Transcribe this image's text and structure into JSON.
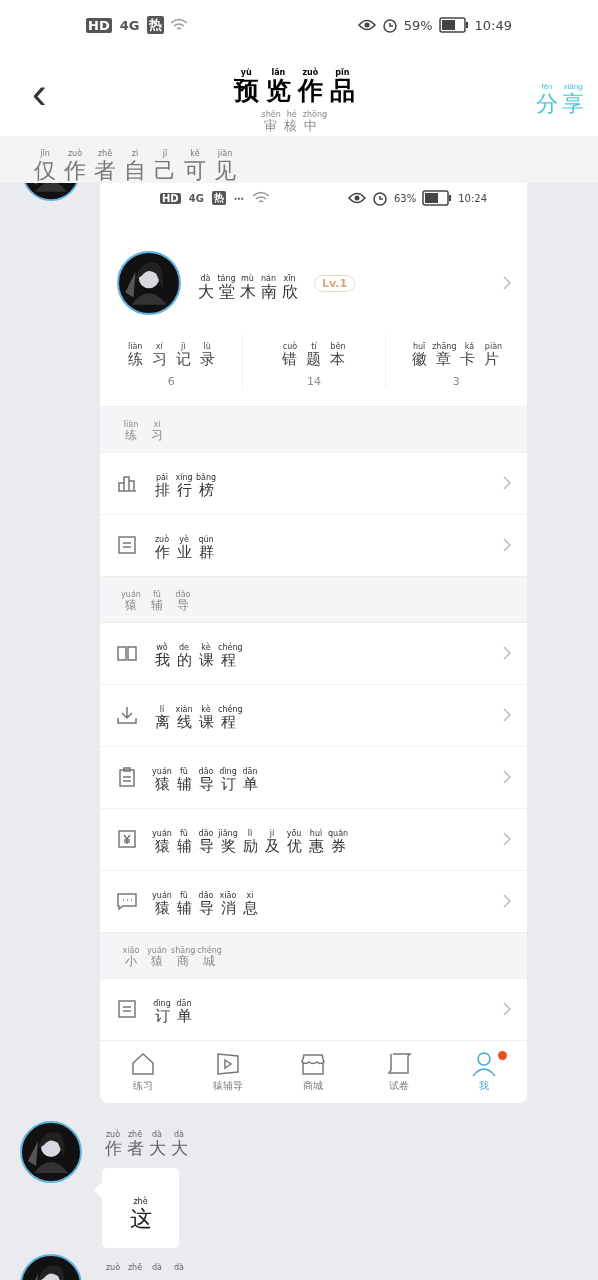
{
  "status_bar": {
    "left": [
      "HD",
      "4G",
      "热"
    ],
    "battery_level": "59%",
    "time": "10:49"
  },
  "header": {
    "back": "‹",
    "title": {
      "text": "预览作品",
      "pinyin": "yù lǎn zuò pǐn"
    },
    "subtitle": {
      "text": "审核中",
      "pinyin": "shěn hé zhōng"
    },
    "action": {
      "text": "分享",
      "pinyin": "fēn xiǎng"
    }
  },
  "notice": {
    "text": "仅作者自己可见",
    "pinyin": "jǐn zuò zhě zì jǐ kě jiàn"
  },
  "shot": {
    "status_bar": {
      "left": [
        "HD",
        "4G",
        "热",
        "⋯"
      ],
      "battery_level": "63%",
      "time": "10:24"
    },
    "profile": {
      "name": {
        "text": "大堂木南欣",
        "pinyin": "dà táng mù nán xīn"
      },
      "badge": "Lv.1"
    },
    "stats": [
      {
        "label": {
          "text": "练习记录",
          "pinyin": "liàn xí jì lù"
        },
        "value": "6"
      },
      {
        "label": {
          "text": "错题本",
          "pinyin": "cuò tí běn"
        },
        "value": "14"
      },
      {
        "label": {
          "text": "徽章卡片",
          "pinyin": "huī zhāng kǎ piàn"
        },
        "value": "3"
      }
    ],
    "sections": [
      {
        "title": {
          "text": "练习",
          "pinyin": "liàn xí"
        },
        "items": [
          {
            "kind": "chart",
            "label": {
              "text": "排行榜",
              "pinyin": "pái xíng bǎng"
            }
          },
          {
            "kind": "list",
            "label": {
              "text": "作业群",
              "pinyin": "zuò yè qún"
            }
          }
        ]
      },
      {
        "title": {
          "text": "猿辅导",
          "pinyin": "yuán fǔ dǎo"
        },
        "items": [
          {
            "kind": "book",
            "label": {
              "text": "我的课程",
              "pinyin": "wǒ de kè chéng"
            }
          },
          {
            "kind": "download",
            "label": {
              "text": "离线课程",
              "pinyin": "lí xiàn kè chéng"
            }
          },
          {
            "kind": "clipboard",
            "label": {
              "text": "猿辅导订单",
              "pinyin": "yuán fǔ dǎo dìng dān"
            }
          },
          {
            "kind": "yen",
            "label": {
              "text": "猿辅导奖励及优惠券",
              "pinyin": "yuán fǔ dǎo jiǎng lì jí yōu huì quàn"
            }
          },
          {
            "kind": "message",
            "label": {
              "text": "猿辅导消息",
              "pinyin": "yuán fǔ dǎo xiāo xi"
            }
          }
        ]
      },
      {
        "title": {
          "text": "小猿商城",
          "pinyin": "xiǎo yuán shāng chéng"
        },
        "items": [
          {
            "kind": "list",
            "label": {
              "text": "订单",
              "pinyin": "dìng dān"
            }
          }
        ]
      }
    ],
    "tabs": [
      {
        "kind": "home",
        "label": "练习",
        "selected": false,
        "dot": false
      },
      {
        "kind": "play",
        "label": "猿辅导",
        "selected": false,
        "dot": false
      },
      {
        "kind": "store",
        "label": "商城",
        "selected": false,
        "dot": false
      },
      {
        "kind": "scroll",
        "label": "试卷",
        "selected": false,
        "dot": false
      },
      {
        "kind": "person",
        "label": "我",
        "selected": true,
        "dot": true
      }
    ]
  },
  "comments": [
    {
      "author": {
        "text": "作者大大",
        "pinyin": "zuò zhě dà dà"
      },
      "message": {
        "text": "这",
        "pinyin": "zhè"
      }
    },
    {
      "author": {
        "pinyin": "zuò zhě dà dà"
      }
    }
  ]
}
